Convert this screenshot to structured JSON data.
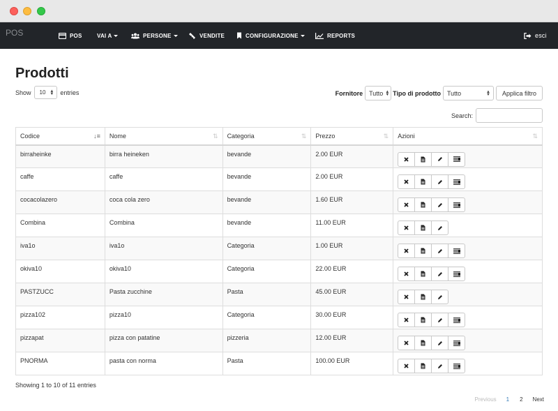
{
  "navbar": {
    "brand": "POS",
    "items": [
      {
        "label": "POS"
      },
      {
        "label": "VAI A"
      },
      {
        "label": "PERSONE"
      },
      {
        "label": "VENDITE"
      },
      {
        "label": "CONFIGURAZIONE"
      },
      {
        "label": "REPORTS"
      }
    ],
    "logout": "esci"
  },
  "page": {
    "title": "Prodotti"
  },
  "length": {
    "show": "Show",
    "value": "10",
    "entries": "entries"
  },
  "filters": {
    "fornitore_label": "Fornitore",
    "fornitore_value": "Tutto",
    "tipo_label": "Tipo di prodotto",
    "tipo_value": "Tutto",
    "apply": "Applica filtro"
  },
  "search": {
    "label": "Search:"
  },
  "table": {
    "columns": [
      "Codice",
      "Nome",
      "Categoria",
      "Prezzo",
      "Azioni"
    ],
    "rows": [
      {
        "codice": "birraheinke",
        "nome": "birra heineken",
        "categoria": "bevande",
        "prezzo": "2.00 EUR",
        "has_details": true
      },
      {
        "codice": "caffe",
        "nome": "caffe",
        "categoria": "bevande",
        "prezzo": "2.00 EUR",
        "has_details": true
      },
      {
        "codice": "cocacolazero",
        "nome": "coca cola zero",
        "categoria": "bevande",
        "prezzo": "1.60 EUR",
        "has_details": true
      },
      {
        "codice": "Combina",
        "nome": "Combina",
        "categoria": "bevande",
        "prezzo": "11.00 EUR",
        "has_details": false
      },
      {
        "codice": "iva1o",
        "nome": "iva1o",
        "categoria": "Categoria",
        "prezzo": "1.00 EUR",
        "has_details": true
      },
      {
        "codice": "okiva10",
        "nome": "okiva10",
        "categoria": "Categoria",
        "prezzo": "22.00 EUR",
        "has_details": true
      },
      {
        "codice": "PASTZUCC",
        "nome": "Pasta zucchine",
        "categoria": "Pasta",
        "prezzo": "45.00 EUR",
        "has_details": false
      },
      {
        "codice": "pizza102",
        "nome": "pizza10",
        "categoria": "Categoria",
        "prezzo": "30.00 EUR",
        "has_details": true
      },
      {
        "codice": "pizzapat",
        "nome": "pizza con patatine",
        "categoria": "pizzeria",
        "prezzo": "12.00 EUR",
        "has_details": true
      },
      {
        "codice": "PNORMA",
        "nome": "pasta con norma",
        "categoria": "Pasta",
        "prezzo": "100.00 EUR",
        "has_details": true
      }
    ]
  },
  "info": "Showing 1 to 10 of 11 entries",
  "pagination": {
    "previous": "Previous",
    "pages": [
      "1",
      "2"
    ],
    "next": "Next"
  },
  "icons": {
    "delete": "times-icon",
    "document": "file-icon",
    "edit": "pencil-icon",
    "details": "list-icon"
  }
}
